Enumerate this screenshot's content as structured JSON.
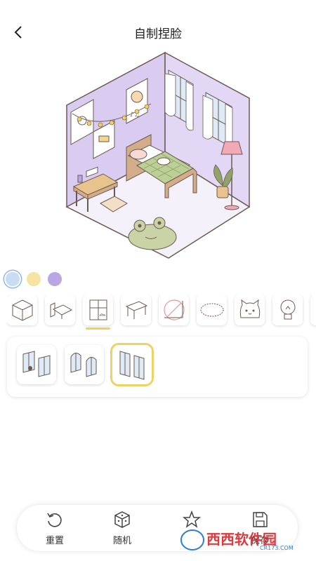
{
  "header": {
    "title": "自制捏脸"
  },
  "colors": {
    "wall_left": "#d9ccf0",
    "wall_right": "#e2d7f5",
    "floor": "#f4f0fb",
    "accent_yellow": "#f2cf55",
    "swatch_blue": "#c8dcf4",
    "swatch_yellow": "#f7e2a0",
    "swatch_purple": "#b9a7e3"
  },
  "swatches": [
    {
      "name": "blue",
      "color": "#c8dcf4",
      "selected": true
    },
    {
      "name": "yellow",
      "color": "#f7e2a0",
      "selected": false
    },
    {
      "name": "purple",
      "color": "#b9a7e3",
      "selected": false
    }
  ],
  "categories": [
    {
      "icon": "room-cube-icon",
      "active": false
    },
    {
      "icon": "bed-icon",
      "active": false
    },
    {
      "icon": "window-icon",
      "active": true
    },
    {
      "icon": "table-icon",
      "active": false
    },
    {
      "icon": "none-icon",
      "active": false
    },
    {
      "icon": "rug-icon",
      "active": false
    },
    {
      "icon": "cat-icon",
      "active": false
    },
    {
      "icon": "lightbulb-icon",
      "active": false
    }
  ],
  "items": [
    {
      "icon": "window-with-cat-icon",
      "selected": false
    },
    {
      "icon": "arched-windows-icon",
      "selected": false
    },
    {
      "icon": "tall-windows-icon",
      "selected": true
    }
  ],
  "tabbar": {
    "reset_label": "重置",
    "random_label": "随机",
    "favorite_label": "收藏",
    "save_label": "保存"
  },
  "watermark": {
    "text": "西西软件园",
    "sub": "CR173.COM"
  }
}
